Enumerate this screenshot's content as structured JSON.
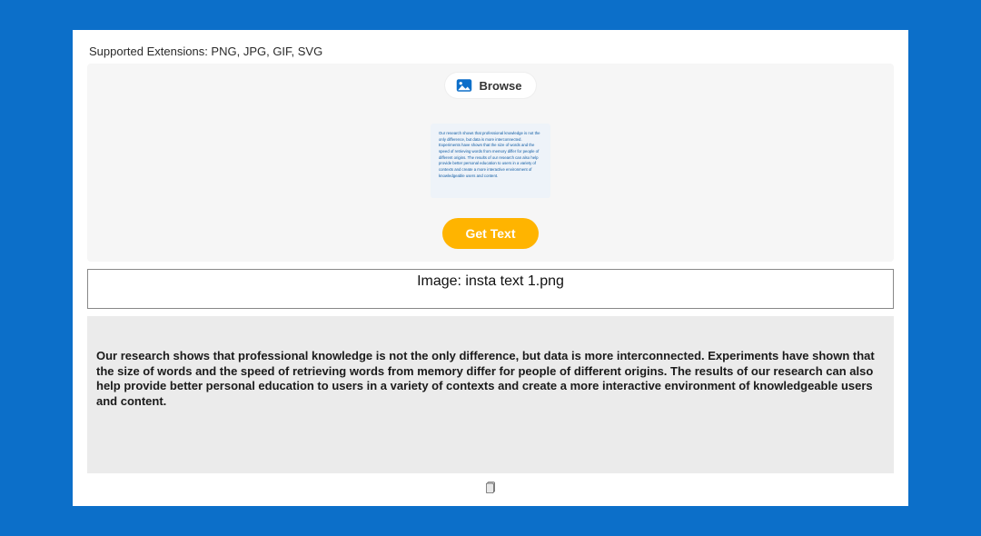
{
  "supported_label": "Supported Extensions: PNG, JPG, GIF, SVG",
  "browse_label": "Browse",
  "preview_text": "Our research shows that professional knowledge is not the only difference, but data is more interconnected. Experiments have shown that the size of words and the speed of retrieving words from memory differ for people of different origins. The results of our research can also help provide better personal education to users in a variety of contexts and create a more interactive environment of knowledgeable users and content.",
  "get_text_label": "Get Text",
  "image_name_prefix": "Image: ",
  "image_name": "insta text 1.png",
  "result_text": "Our research shows that professional knowledge is not the only difference, but data is more interconnected. Experiments have shown that the size of words and the speed of retrieving words from memory differ for people of different origins. The results of our research can also help provide better personal education to users in a variety of contexts and create a more interactive environment of knowledgeable users and content.",
  "colors": {
    "background": "#0c6fc9",
    "accent": "#ffb400",
    "panel": "#f6f6f6",
    "result_bg": "#ebebeb"
  }
}
